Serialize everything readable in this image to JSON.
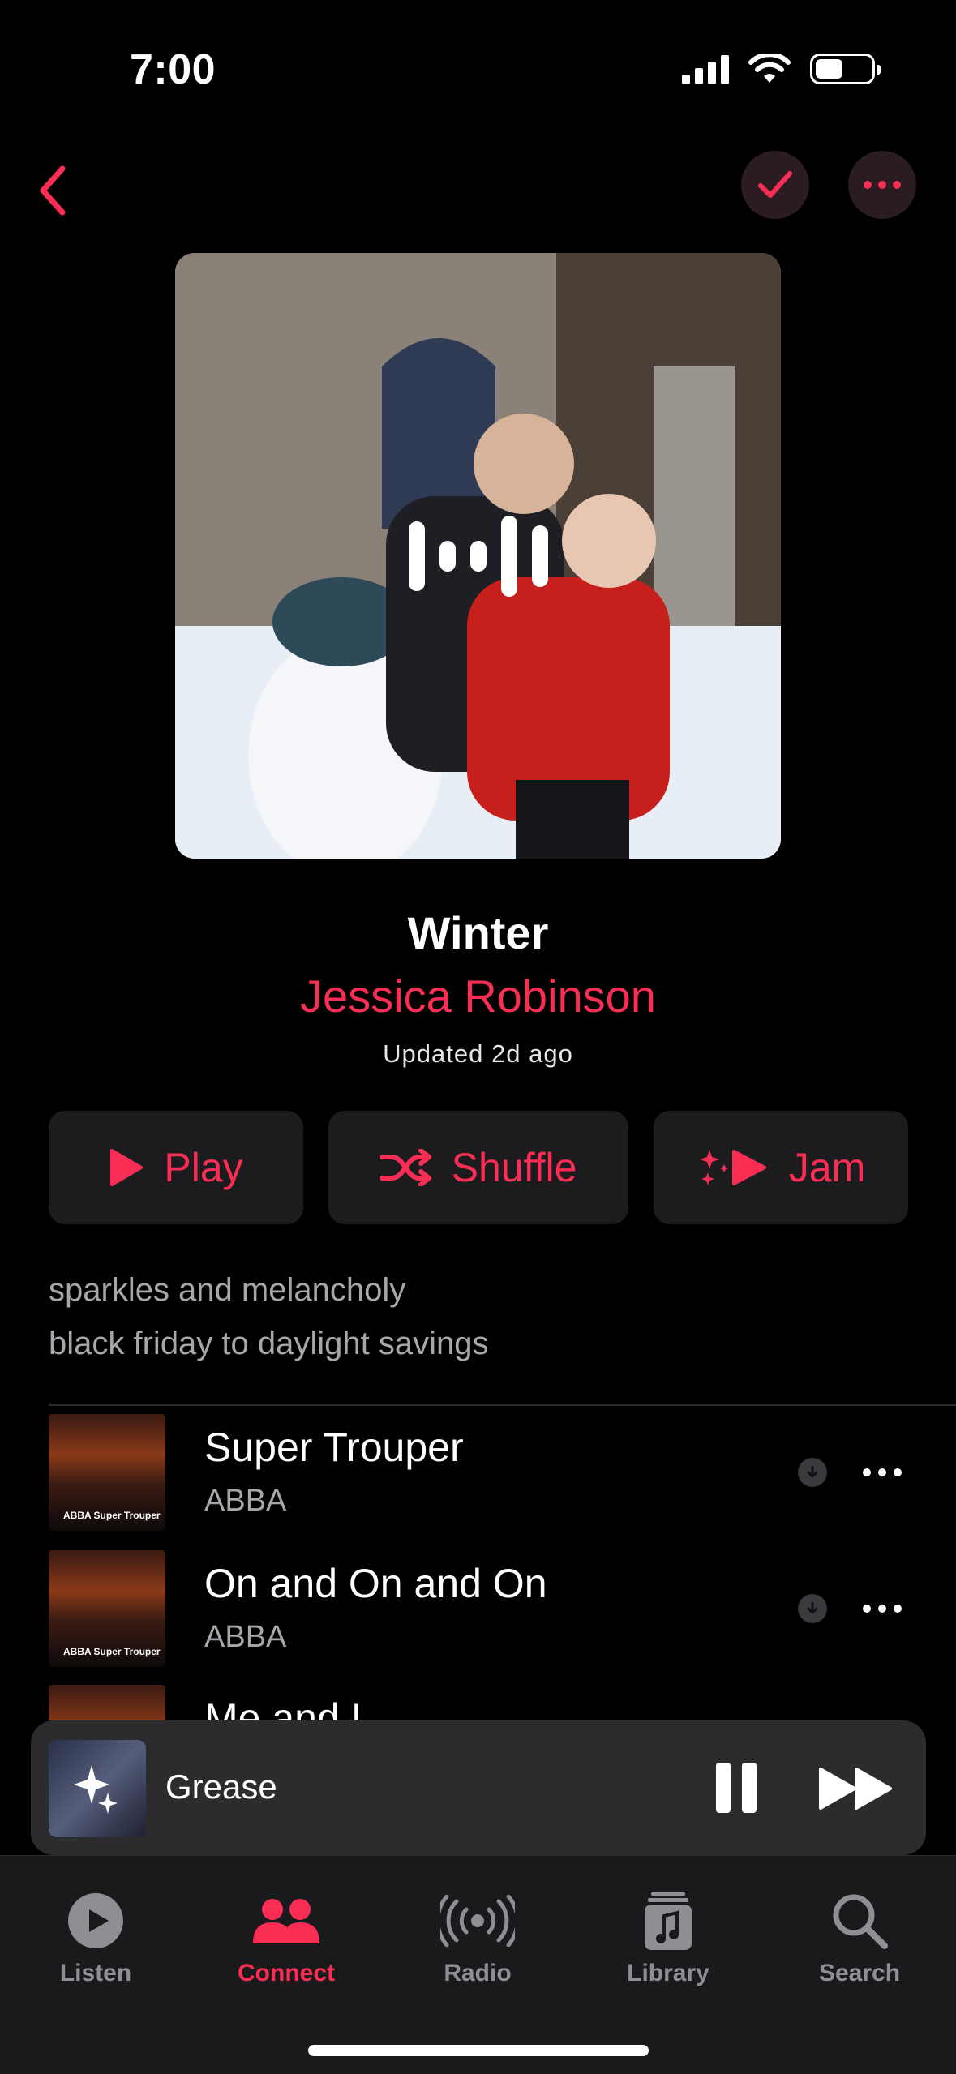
{
  "status_bar": {
    "time": "7:00"
  },
  "playlist": {
    "title": "Winter",
    "curator": "Jessica Robinson",
    "updated": "Updated 2d ago",
    "description_lines": [
      "sparkles and melancholy",
      "black friday to daylight savings"
    ]
  },
  "actions": {
    "play": "Play",
    "shuffle": "Shuffle",
    "jam": "Jam"
  },
  "tracks": [
    {
      "title": "Super Trouper",
      "artist": "ABBA",
      "art_label": "ABBA Super Trouper"
    },
    {
      "title": "On and On and On",
      "artist": "ABBA",
      "art_label": "ABBA Super Trouper"
    },
    {
      "title": "Me and I",
      "artist": ""
    }
  ],
  "mini_player": {
    "title": "Grease",
    "state": "playing"
  },
  "tabs": [
    {
      "label": "Listen",
      "icon": "play-circle-icon"
    },
    {
      "label": "Connect",
      "icon": "people-icon",
      "active": true
    },
    {
      "label": "Radio",
      "icon": "radio-broadcast-icon"
    },
    {
      "label": "Library",
      "icon": "library-music-icon"
    },
    {
      "label": "Search",
      "icon": "magnifier-icon"
    }
  ],
  "colors": {
    "accent": "#fa2d55",
    "background": "#000000",
    "button_bg": "#1c1c1e",
    "secondary_text": "#a6a6ab"
  }
}
